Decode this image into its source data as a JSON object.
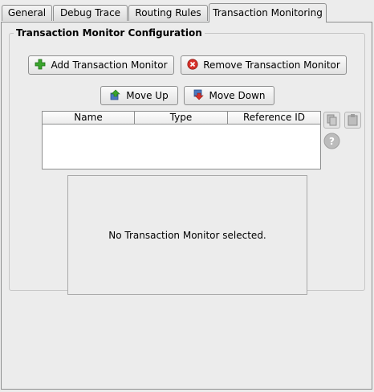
{
  "tabs": [
    {
      "label": "General",
      "active": false
    },
    {
      "label": "Debug Trace",
      "active": false
    },
    {
      "label": "Routing Rules",
      "active": false
    },
    {
      "label": "Transaction Monitoring",
      "active": true
    }
  ],
  "group": {
    "title": "Transaction Monitor Configuration",
    "add_button": {
      "label": "Add Transaction Monitor",
      "icon": "plus-icon"
    },
    "remove_button": {
      "label": "Remove Transaction Monitor",
      "icon": "remove-icon"
    },
    "move_up_button": {
      "label": "Move Up",
      "icon": "move-up-icon"
    },
    "move_down_button": {
      "label": "Move Down",
      "icon": "move-down-icon"
    },
    "table": {
      "columns": [
        "Name",
        "Type",
        "Reference ID"
      ],
      "rows": []
    },
    "side_buttons": [
      "copy-icon",
      "paste-icon",
      "help-icon"
    ],
    "detail_message": "No Transaction Monitor selected."
  },
  "colors": {
    "background": "#ececec",
    "border": "#8e8f8f",
    "add_green": "#3aa52c",
    "remove_red": "#d8312a"
  }
}
